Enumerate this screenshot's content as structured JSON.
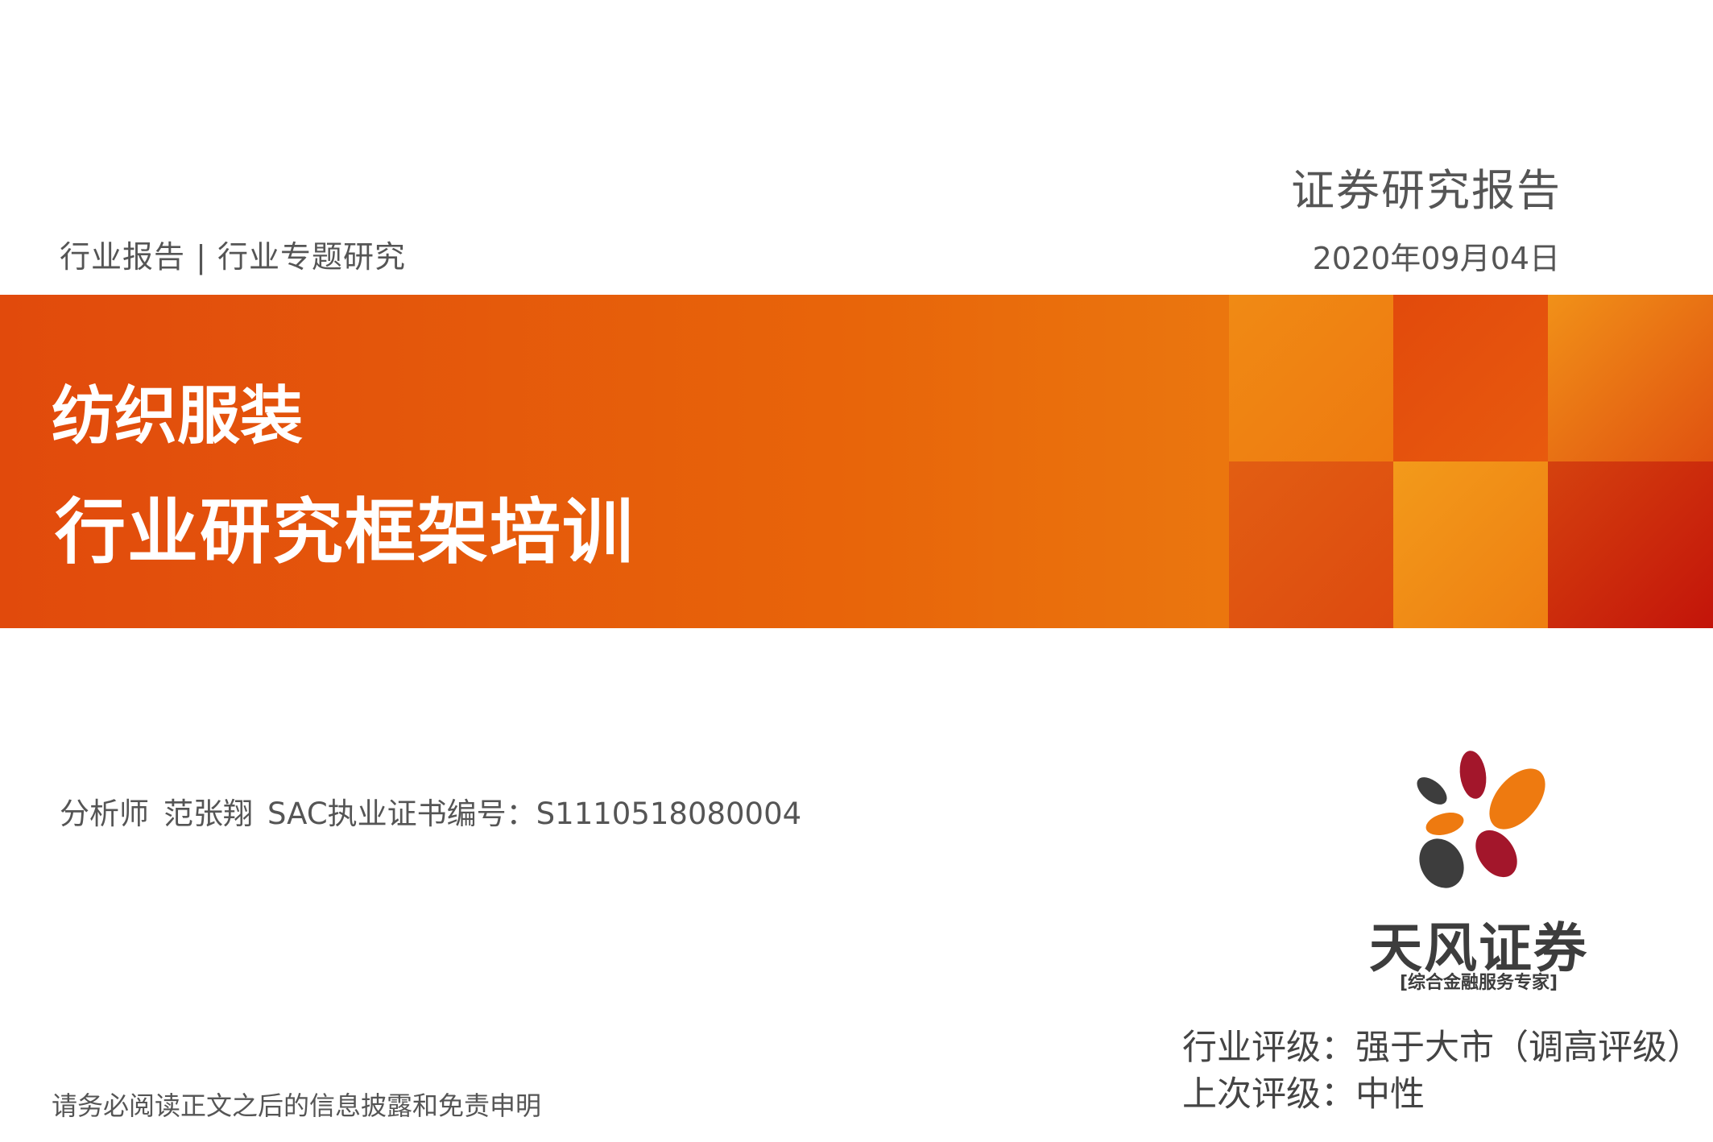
{
  "header": {
    "report_type": "行业报告 | 行业专题研究",
    "doc_kind": "证券研究报告",
    "date": "2020年09月04日"
  },
  "banner": {
    "industry": "纺织服装",
    "title": "行业研究框架培训"
  },
  "analyst": {
    "role": "分析师",
    "name": "范张翔",
    "license": "SAC执业证书编号：S1110518080004"
  },
  "logo": {
    "name": "天风证券",
    "tagline": "[综合金融服务专家]"
  },
  "ratings": {
    "industry_rating": "行业评级：强于大市（调高评级）",
    "previous_rating": "上次评级：中性"
  },
  "footer": {
    "disclaimer": "请务必阅读正文之后的信息披露和免责申明"
  },
  "colors": {
    "banner_orange": "#e8650a",
    "logo_red": "#a3162b",
    "logo_orange": "#ee7a10",
    "logo_dark": "#3d3d3d"
  }
}
